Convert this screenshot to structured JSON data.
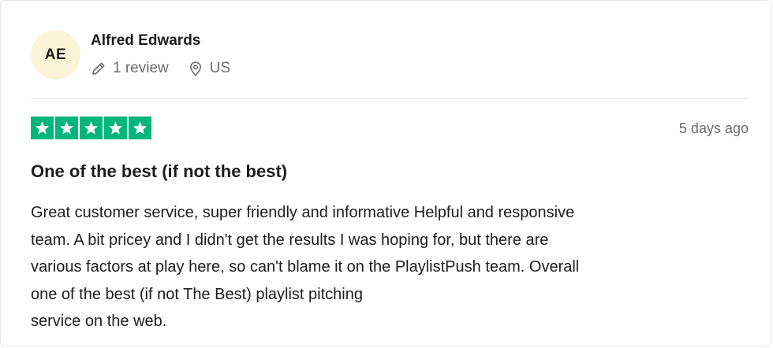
{
  "reviewer": {
    "initials": "AE",
    "name": "Alfred Edwards",
    "review_count": "1 review",
    "country": "US",
    "avatar_color": "#fbf4d8"
  },
  "rating": {
    "stars": 5,
    "max": 5,
    "color": "#00b67a"
  },
  "review": {
    "date": "5 days ago",
    "title": "One of the best (if not the best)",
    "lines": [
      "Great customer service, super friendly and informative Helpful and responsive",
      "team. A bit pricey and I didn't get the results I was hoping for, but there are",
      "various factors at play here, so can't blame it on the PlaylistPush team. Overall",
      "one of the best (if not The Best) playlist pitching",
      "service on the web."
    ]
  },
  "icons": {
    "review_count": "pencil-icon",
    "country": "location-pin-icon",
    "rating": "star-icon"
  }
}
